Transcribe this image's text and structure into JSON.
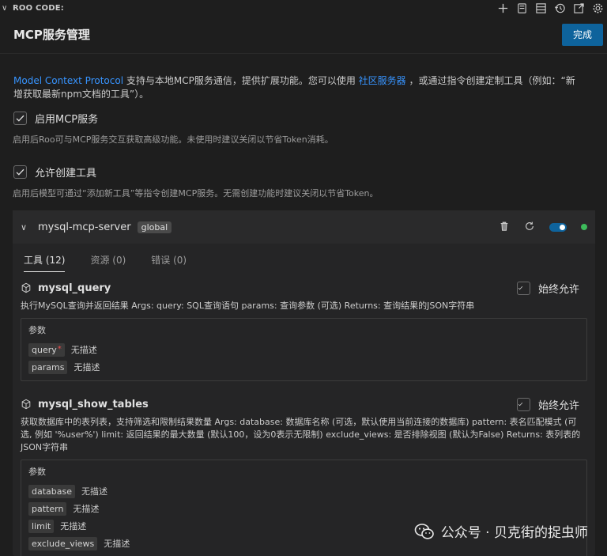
{
  "topbar": {
    "title": "ROO CODE:"
  },
  "header": {
    "title": "MCP服务管理",
    "done_label": "完成"
  },
  "intro": {
    "link1": "Model Context Protocol",
    "text1": " 支持与本地MCP服务通信，提供扩展功能。您可以使用 ",
    "link2": "社区服务器",
    "text2": " ，或通过指令创建定制工具（例如：“新增获取最新npm文档的工具”）。"
  },
  "options": [
    {
      "label": "启用MCP服务",
      "hint": "启用后Roo可与MCP服务交互获取高级功能。未使用时建议关闭以节省Token消耗。"
    },
    {
      "label": "允许创建工具",
      "hint": "启用后模型可通过“添加新工具”等指令创建MCP服务。无需创建功能时建议关闭以节省Token。"
    }
  ],
  "server": {
    "name": "mysql-mcp-server",
    "badge": "global",
    "status_color": "#3dbb5b",
    "tabs": [
      {
        "label": "工具 (12)"
      },
      {
        "label": "资源 (0)"
      },
      {
        "label": "错误 (0)"
      }
    ],
    "always_allow_label": "始终允许",
    "params_title": "参数",
    "tools": [
      {
        "name": "mysql_query",
        "desc": "执行MySQL查询并返回结果 Args: query: SQL查询语句 params: 查询参数 (可选) Returns: 查询结果的JSON字符串",
        "params": [
          {
            "name": "query",
            "required": "*",
            "desc": "无描述"
          },
          {
            "name": "params",
            "required": "",
            "desc": "无描述"
          }
        ]
      },
      {
        "name": "mysql_show_tables",
        "desc": "获取数据库中的表列表，支持筛选和限制结果数量 Args: database: 数据库名称 (可选，默认使用当前连接的数据库) pattern: 表名匹配模式 (可选, 例如 '%user%') limit: 返回结果的最大数量 (默认100，设为0表示无限制) exclude_views: 是否排除视图 (默认为False) Returns: 表列表的JSON字符串",
        "params": [
          {
            "name": "database",
            "required": "",
            "desc": "无描述"
          },
          {
            "name": "pattern",
            "required": "",
            "desc": "无描述"
          },
          {
            "name": "limit",
            "required": "",
            "desc": "无描述"
          },
          {
            "name": "exclude_views",
            "required": "",
            "desc": "无描述"
          }
        ]
      }
    ]
  },
  "watermark": {
    "text": "公众号 · 贝克街的捉虫师"
  }
}
